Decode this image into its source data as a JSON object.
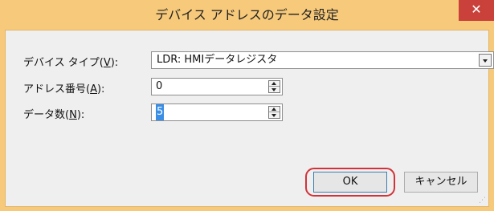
{
  "window": {
    "title": "デバイス アドレスのデータ設定",
    "close_glyph": "✕"
  },
  "fields": {
    "device_type": {
      "label": "デバイス タイプ(",
      "mnemonic": "V",
      "label_end": "):",
      "value": "LDR: HMIデータレジスタ"
    },
    "address": {
      "label": "アドレス番号(",
      "mnemonic": "A",
      "label_end": "):",
      "value": "0"
    },
    "data_count": {
      "label": "データ数(",
      "mnemonic": "N",
      "label_end": "):",
      "value": "5"
    }
  },
  "buttons": {
    "ok": "OK",
    "cancel": "キャンセル"
  },
  "colors": {
    "titlebar": "#f7c97a",
    "close": "#c9413a",
    "highlight": "#d2333a",
    "selection": "#3a8ee6"
  },
  "icons": {
    "close": "close-icon",
    "combo": "chevron-down-icon",
    "spin_up": "arrow-up-icon",
    "spin_down": "arrow-down-icon"
  }
}
